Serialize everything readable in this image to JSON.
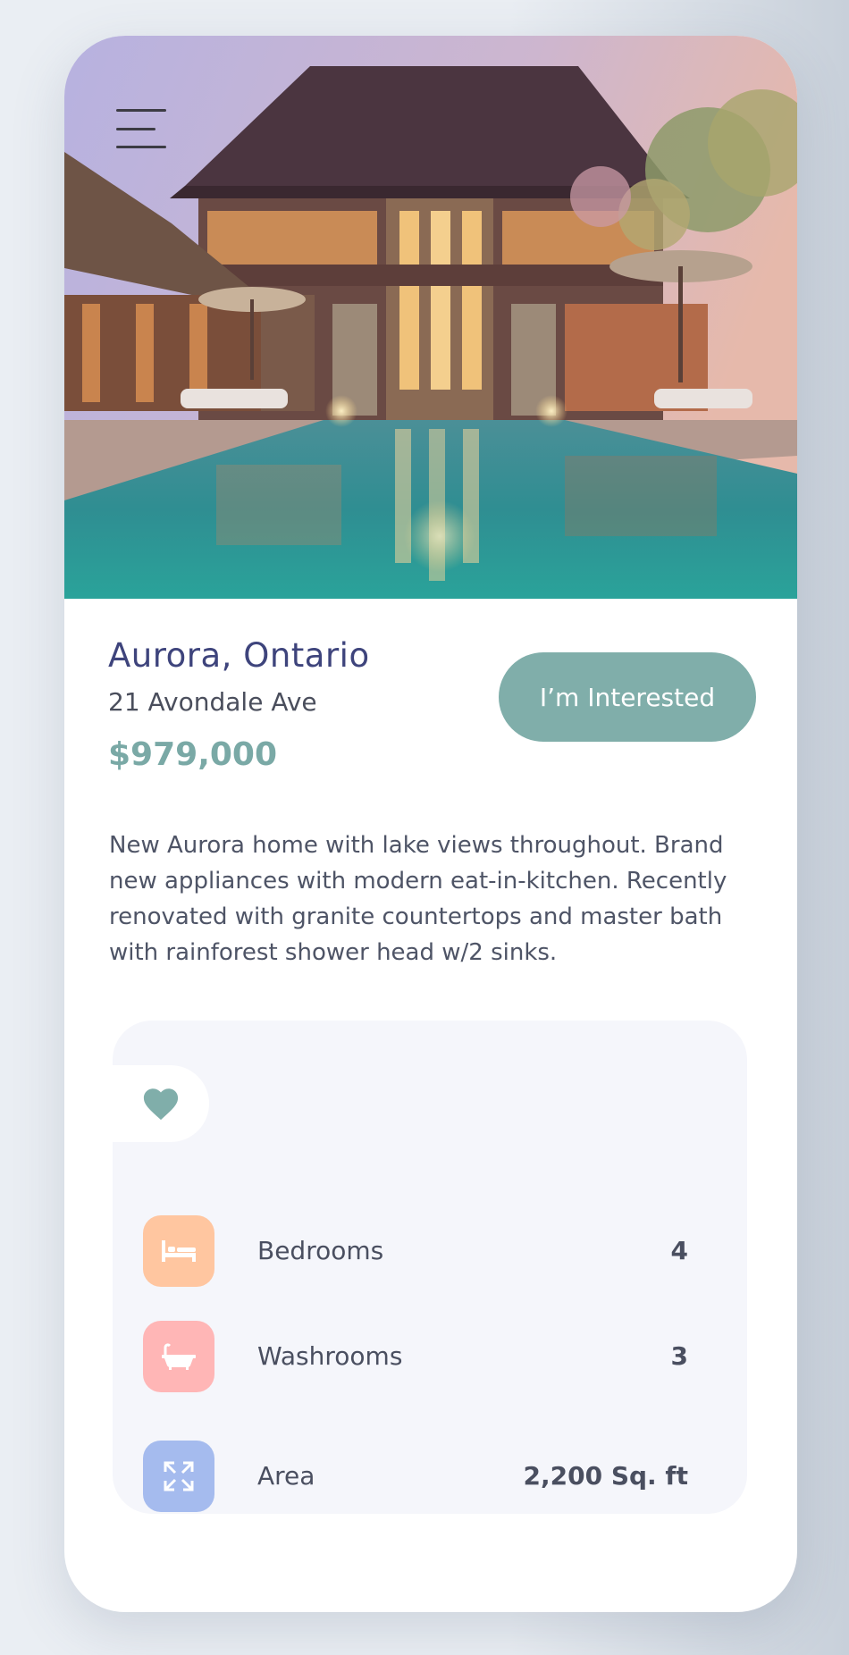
{
  "listing": {
    "city": "Aurora, Ontario",
    "address": "21 Avondale Ave",
    "price": "$979,000",
    "cta_label": "I’m Interested",
    "description": "New Aurora home with lake views throughout. Brand new appliances with modern eat-in-kitchen. Recently renovated with granite countertops and master bath with rainforest shower head w/2 sinks."
  },
  "features": [
    {
      "label": "Bedrooms",
      "value": "4",
      "icon": "bed-icon",
      "color": "#ffc6a0"
    },
    {
      "label": "Washrooms",
      "value": "3",
      "icon": "bathtub-icon",
      "color": "#ffb6b6"
    },
    {
      "label": "Area",
      "value": "2,200 Sq. ft",
      "icon": "expand-icon",
      "color": "#a5bbee"
    }
  ],
  "colors": {
    "accent": "#80aeaa",
    "title": "#3e447c",
    "heart": "#80aeaa"
  },
  "icons": {
    "menu": "menu-icon",
    "favorite": "heart-icon"
  }
}
